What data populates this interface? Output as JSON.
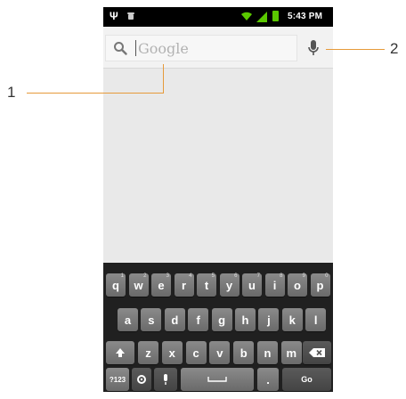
{
  "statusbar": {
    "time": "5:43 PM"
  },
  "search": {
    "placeholder": "Google"
  },
  "keyboard": {
    "row1": [
      {
        "label": "q",
        "sup": "1"
      },
      {
        "label": "w",
        "sup": "2"
      },
      {
        "label": "e",
        "sup": "3"
      },
      {
        "label": "r",
        "sup": "4"
      },
      {
        "label": "t",
        "sup": "5"
      },
      {
        "label": "y",
        "sup": "6"
      },
      {
        "label": "u",
        "sup": "7"
      },
      {
        "label": "i",
        "sup": "8"
      },
      {
        "label": "o",
        "sup": "9"
      },
      {
        "label": "p",
        "sup": "0"
      }
    ],
    "row2": [
      "a",
      "s",
      "d",
      "f",
      "g",
      "h",
      "j",
      "k",
      "l"
    ],
    "row3": [
      "z",
      "x",
      "c",
      "v",
      "b",
      "n",
      "m"
    ],
    "symbols_label": "?123",
    "period_label": ".",
    "go_label": "Go"
  },
  "callouts": {
    "one": "1",
    "two": "2"
  },
  "colors": {
    "callout": "#e69a3a",
    "battery": "#5ac800",
    "statusbar": "#000000",
    "keyboard_bg": "#202020"
  }
}
